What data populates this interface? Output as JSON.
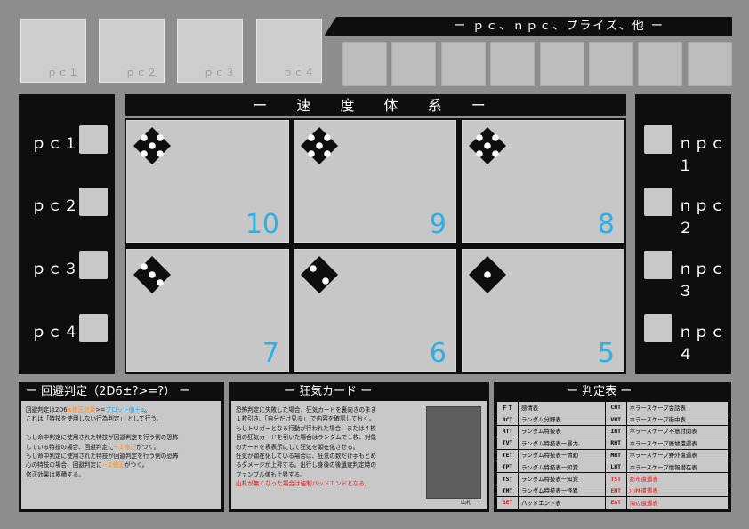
{
  "pc_cards": [
    "ｐｃ１",
    "ｐｃ２",
    "ｐｃ３",
    "ｐｃ４"
  ],
  "npc_banner": "ー ｐｃ、ｎｐｃ、プライズ、他 ー",
  "left_panel": [
    "ｐｃ１",
    "ｐｃ２",
    "ｐｃ３",
    "ｐｃ４"
  ],
  "right_panel": [
    "ｎｐｃ１",
    "ｎｐｃ２",
    "ｎｐｃ３",
    "ｎｐｃ４"
  ],
  "speed": {
    "title": "ー 速 度 体 系 ー",
    "cells": [
      {
        "pips": 5,
        "number": "10"
      },
      {
        "pips": 5,
        "number": "9"
      },
      {
        "pips": 5,
        "number": "8"
      },
      {
        "pips": 3,
        "number": "7"
      },
      {
        "pips": 2,
        "number": "6"
      },
      {
        "pips": 1,
        "number": "5"
      }
    ]
  },
  "evasion": {
    "title": "ー 回避判定（2D6±?>=?） ー",
    "l1a": "回避判定は2D6",
    "l1b": "±修正効果",
    "l1c": ">=",
    "l1d": "プロット値＋α",
    "l1e": "。",
    "l2": "これは「特技を使用しない行為判定」 として行う。",
    "l3": "もし命中判定に使用された特技が回避判定を行う側の恐怖",
    "l4a": "している特技の場合、回避判定に",
    "l4b": "−１修正",
    "l4c": "がつく。",
    "l5": "もし命中判定に使用された特技が回避判定を行う側の恐怖",
    "l6a": "心の特技の場合、回避判定に",
    "l6b": "−２修正",
    "l6c": "がつく。",
    "l7": "修正効果は累積する。"
  },
  "madness": {
    "title": "ー 狂気カード ー",
    "l1": "恐怖判定に失敗した場合、狂気カードを裏向きのまま",
    "l2": "１枚引き、「自分だけ見る」 で内容を確認しておく。",
    "l3": "もしトリガーとなる行動が行われた場合、または４枚",
    "l4": "目の狂気カードを引いた場合はランダムで１枚、対象",
    "l5": "のカードを表表示にして狂気を顕在化させる。",
    "l6": "狂気が顕在化している場合は、狂気の数だけ手もとめ",
    "l7": "るダメージが上昇する。出行し身後の後遺症判定時の",
    "l8": "ファンブル値も上昇する。",
    "l9": "山札が無くなった場合は強制バッドエンドとなる。",
    "deck_label": "山札"
  },
  "judge": {
    "title": "ー 判定表 ー",
    "rows": [
      [
        "ＦＴ",
        "感情表",
        "CHT",
        "ホラースケープ会話表"
      ],
      [
        "RCT",
        "ランダム分野表",
        "VHT",
        "ホラースケープ街中表"
      ],
      [
        "RTT",
        "ランダム特技表",
        "IHT",
        "ホラースケープ不意討関表"
      ],
      [
        "TVT",
        "ランダム特技表ー暴力",
        "RHT",
        "ホラースケープ廃墟遭遇表"
      ],
      [
        "TET",
        "ランダム特技表ー情動",
        "MHT",
        "ホラースケープ野外遭遇表"
      ],
      [
        "TPT",
        "ランダム特技表ー知覚",
        "LHT",
        "ホラースケープ情報潜在表"
      ],
      [
        "TST",
        "ランダム特技表ー知覚",
        "TST",
        "都市遭遇表"
      ],
      [
        "TMT",
        "ランダム特技表ー怪異",
        "EMT",
        "山林遭遇表"
      ],
      [
        "BET",
        "バッドエンド表",
        "EAT",
        "海辺遭遇表"
      ]
    ]
  },
  "colors": {
    "text_highlight_orange": "#ff8a1a",
    "text_highlight_blue": "#1aa6e6",
    "text_warning_red": "#e31b1b",
    "speed_number": "#2ab0e8"
  }
}
